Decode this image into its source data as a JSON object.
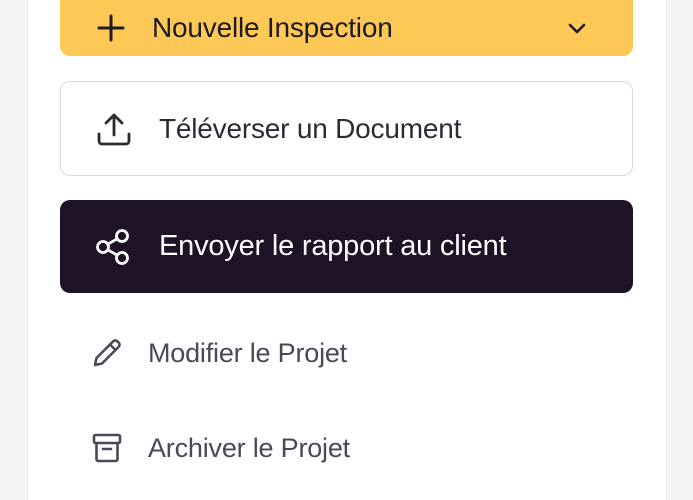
{
  "actions": {
    "new_inspection": {
      "label": "Nouvelle Inspection",
      "icon": "plus-icon",
      "trailing_icon": "chevron-down-icon",
      "color": "#fdc856"
    },
    "upload_document": {
      "label": "Téléverser un Document",
      "icon": "upload-icon"
    },
    "send_report": {
      "label": "Envoyer le rapport au client",
      "icon": "share-icon",
      "color": "#1e1226"
    },
    "edit_project": {
      "label": "Modifier le Projet",
      "icon": "pencil-icon"
    },
    "archive_project": {
      "label": "Archiver le Projet",
      "icon": "archive-icon"
    }
  }
}
